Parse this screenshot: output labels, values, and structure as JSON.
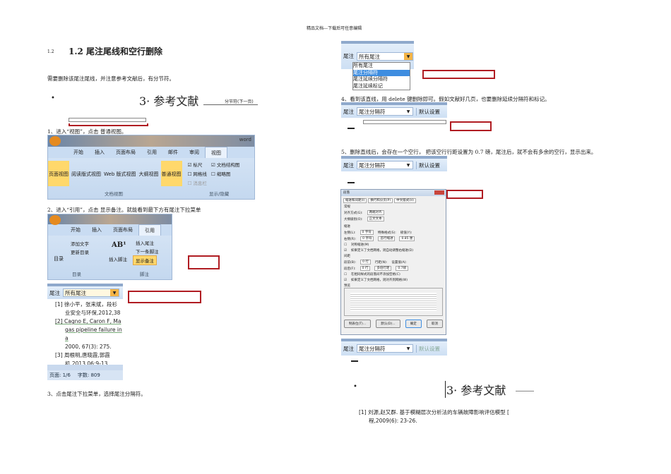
{
  "header": "精品文档---下载后可任意编辑",
  "left": {
    "num": "1.2",
    "heading": "1.2  尾注尾线和空行删除",
    "intro": "需要删除该尾注尾线，并注意参考文献后，有分节符。",
    "ref_heading": "3· 参考文献",
    "section_break": "分节符(下一页)",
    "step1": "1、进入“视图”，点击 普通视图。",
    "ribbon1": {
      "word": "word",
      "tabs": [
        "开始",
        "插入",
        "页面布局",
        "引用",
        "邮件",
        "审阅",
        "视图"
      ],
      "buttons": [
        "页面视图",
        "阅读版式视图",
        "Web 版式视图",
        "大纲视图",
        "普通视图"
      ],
      "checks": [
        {
          "label": "标尺",
          "checked": true
        },
        {
          "label": "文档结构图",
          "checked": true
        },
        {
          "label": "网格线",
          "checked": false
        },
        {
          "label": "缩略图",
          "checked": false
        },
        {
          "label": "消息栏",
          "checked": false
        }
      ],
      "groups": [
        "文档视图",
        "显示/隐藏"
      ]
    },
    "step2": "2、进入“引用”，点击 显示备注。就能看到最下方有尾注下拉菜单",
    "ribbon2": {
      "tabs": [
        "开始",
        "插入",
        "页面布局",
        "引用"
      ],
      "toc": "目录",
      "add_text": "添加文字",
      "update_toc": "更新目录",
      "insert_footnote": "插入脚注",
      "insert_endnote": "插入尾注",
      "next_footnote": "下一条脚注",
      "show_notes": "显示备注",
      "groups": [
        "目录",
        "脚注"
      ]
    },
    "fn_label": "尾注",
    "fn_select": "所有尾注",
    "refs": [
      "[1] 徐小平，张来斌，段衫",
      "业安全与环保,2012,38",
      "[2] Cagno E, Caron F, Ma",
      "gas pipeline failure in a",
      "2000, 67(3): 275.",
      "[3] 周根明,唐晓霞,郭霞",
      "机,2013,06:9-13."
    ],
    "status": {
      "page": "页面: 1/6",
      "words": "字数: 809"
    },
    "step3": "3、点击尾注下拉菜单，选择尾注分隔符。"
  },
  "right": {
    "fn_label": "尾注",
    "fn_select": "所有尾注",
    "options": [
      "所有尾注",
      "尾注分隔符",
      "尾注延续分隔符",
      "尾注延续标记"
    ],
    "step4": "4、看到该直线，用 delete 键删除即可。假如文献好几页，也要删除延续分隔符和标记。",
    "sep_select": "尾注分隔符",
    "default": "默认设置",
    "step5": "5、删除直线后，会存在一个空行，  把该空行行距设置为 0.7 磅，尾注后，就不会有多余的空行，显示出来。",
    "dialog": {
      "title": "段落",
      "tabs": [
        "缩进和间距(I)",
        "换行和分页(P)",
        "中文版式(H)"
      ],
      "general": "常规",
      "align_label": "对齐方式(G):",
      "align": "两端对齐",
      "outline_label": "大纲级别(O):",
      "outline": "正文文本",
      "indent": "缩进",
      "left_label": "左侧(L):",
      "left": "0 字符",
      "right_label": "右侧(R):",
      "right": "0 字符",
      "special_label": "特殊格式(S):",
      "special": "首行缩进",
      "by_label": "磅值(Y):",
      "by": "0.85 厘",
      "mirror": "对称缩进(M)",
      "grid1": "如果定义了文档网格，则自动调整右缩进(D)",
      "spacing": "间距",
      "before_label": "段前(B):",
      "before": "0 行",
      "after_label": "段后(F):",
      "after": "0 行",
      "line_label": "行距(N):",
      "line": "多倍行距",
      "at_label": "设置值(A):",
      "at": "0.7磅",
      "nospace": "在相同样式的段落间不添加空格(C)",
      "grid2": "如果定义了文档网格，则对齐到网格(W)",
      "preview": "预览",
      "buttons": [
        "制表位(T)...",
        "默认(D)...",
        "确定",
        "取消"
      ]
    },
    "ref_heading": "3· 参考文献",
    "ref": [
      "[1] 刘源,赵又群. 基于模糊层次分析法的车辆故障影响评估模型 [",
      "程,2009(6): 23-26."
    ]
  },
  "colors": {
    "red": "#b01c22",
    "highlight": "#ffd86b",
    "select": "#3e8de0"
  }
}
